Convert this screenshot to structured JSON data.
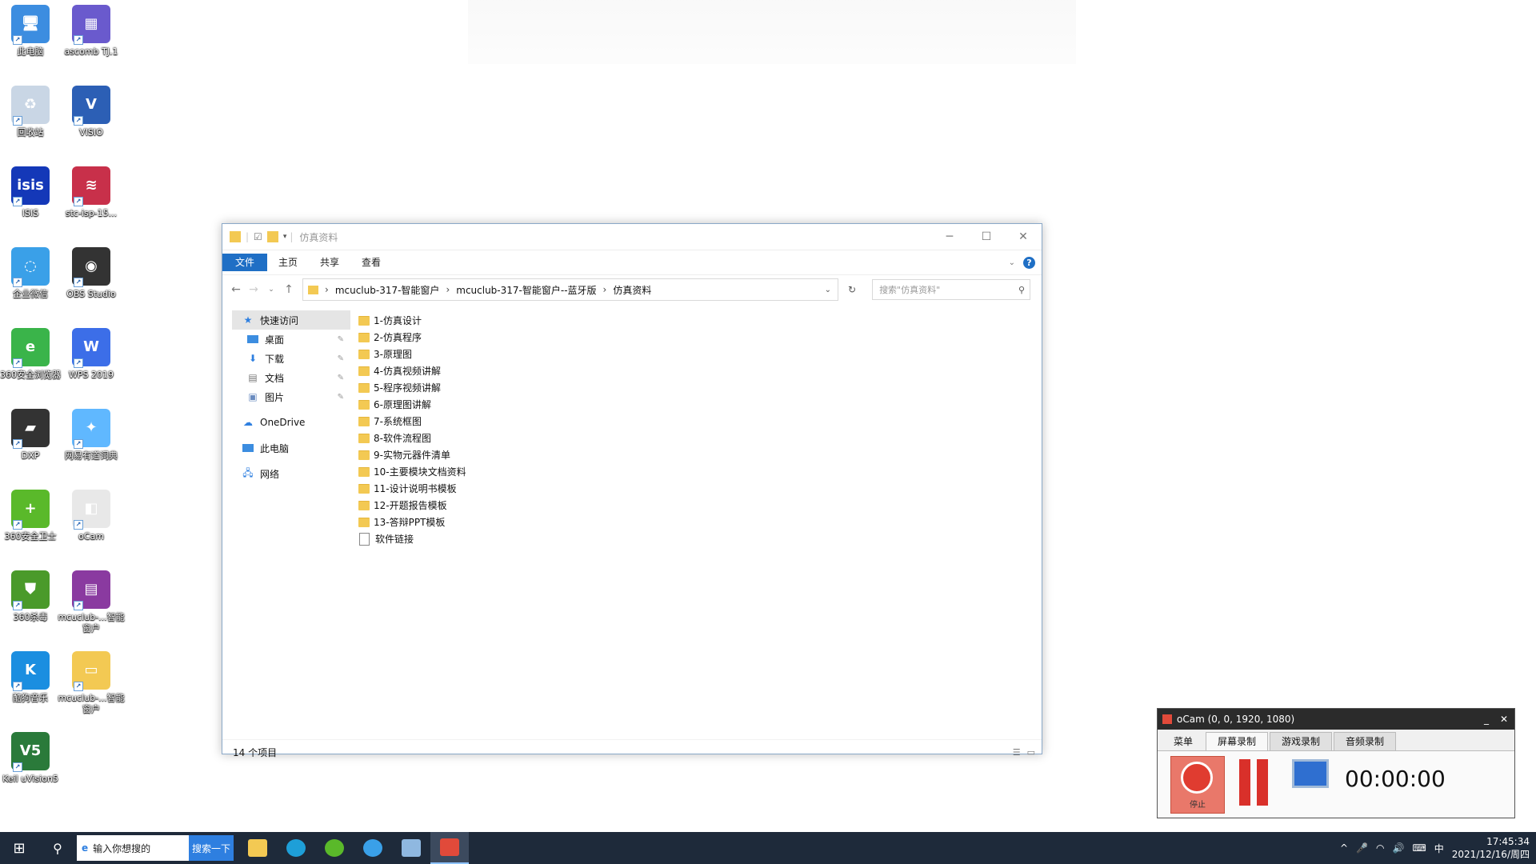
{
  "desktop": {
    "icons": [
      {
        "label": "此电脑",
        "color": "#3c8de0",
        "glyph": "🖥"
      },
      {
        "label": "ascomb TJ.1",
        "color": "#6a5acd",
        "glyph": "▦"
      },
      {
        "label": "回收站",
        "color": "#c9d6e5",
        "glyph": "♻"
      },
      {
        "label": "VISIO",
        "color": "#2c5fb5",
        "glyph": "V"
      },
      {
        "label": "ISIS",
        "color": "#1438b8",
        "glyph": "isis"
      },
      {
        "label": "stc-isp-15...",
        "color": "#c8304a",
        "glyph": "≋"
      },
      {
        "label": "企业微信",
        "color": "#3aa0e8",
        "glyph": "◌"
      },
      {
        "label": "OBS Studio",
        "color": "#333333",
        "glyph": "◉"
      },
      {
        "label": "360安全浏览器",
        "color": "#3ab44a",
        "glyph": "e"
      },
      {
        "label": "WPS 2019",
        "color": "#3c6ee8",
        "glyph": "W"
      },
      {
        "label": "DXP",
        "color": "#333333",
        "glyph": "▰"
      },
      {
        "label": "网易有道词典",
        "color": "#60b8ff",
        "glyph": "✦"
      },
      {
        "label": "360安全卫士",
        "color": "#5ab92a",
        "glyph": "+"
      },
      {
        "label": "oCam",
        "color": "#e8e8e8",
        "glyph": "◧"
      },
      {
        "label": "360杀毒",
        "color": "#4a9a2a",
        "glyph": "⛊"
      },
      {
        "label": "mcuclub-...智能窗户",
        "color": "#8a3aa0",
        "glyph": "▤"
      },
      {
        "label": "酷狗音乐",
        "color": "#1b8ee0",
        "glyph": "K"
      },
      {
        "label": "mcuclub-...智能窗户",
        "color": "#f3c953",
        "glyph": "▭"
      },
      {
        "label": "Keil uVision5",
        "color": "#2a7a3a",
        "glyph": "V5"
      }
    ]
  },
  "explorer": {
    "title": "仿真资料",
    "ribbon_tabs": [
      "文件",
      "主页",
      "共享",
      "查看"
    ],
    "help": "?",
    "breadcrumb": [
      "mcuclub-317-智能窗户",
      "mcuclub-317-智能窗户--蓝牙版",
      "仿真资料"
    ],
    "search_placeholder": "搜索\"仿真资料\"",
    "nav": {
      "quick_access": "快速访问",
      "items": [
        "桌面",
        "下载",
        "文档",
        "图片"
      ],
      "onedrive": "OneDrive",
      "this_pc": "此电脑",
      "network": "网络"
    },
    "files": [
      "1-仿真设计",
      "2-仿真程序",
      "3-原理图",
      "4-仿真视频讲解",
      "5-程序视频讲解",
      "6-原理图讲解",
      "7-系统框图",
      "8-软件流程图",
      "9-实物元器件清单",
      "10-主要模块文档资料",
      "11-设计说明书模板",
      "12-开题报告模板",
      "13-答辩PPT模板",
      "软件链接"
    ],
    "status": "14 个项目"
  },
  "ocam": {
    "title": "oCam (0, 0, 1920, 1080)",
    "tabs": [
      "菜单",
      "屏幕录制",
      "游戏录制",
      "音频录制"
    ],
    "record_label": "停止",
    "timer": "00:00:00"
  },
  "taskbar": {
    "search_text": "输入你想搜的",
    "search_button": "搜索一下",
    "ime": "中",
    "time": "17:45:34",
    "date": "2021/12/16/周四"
  }
}
